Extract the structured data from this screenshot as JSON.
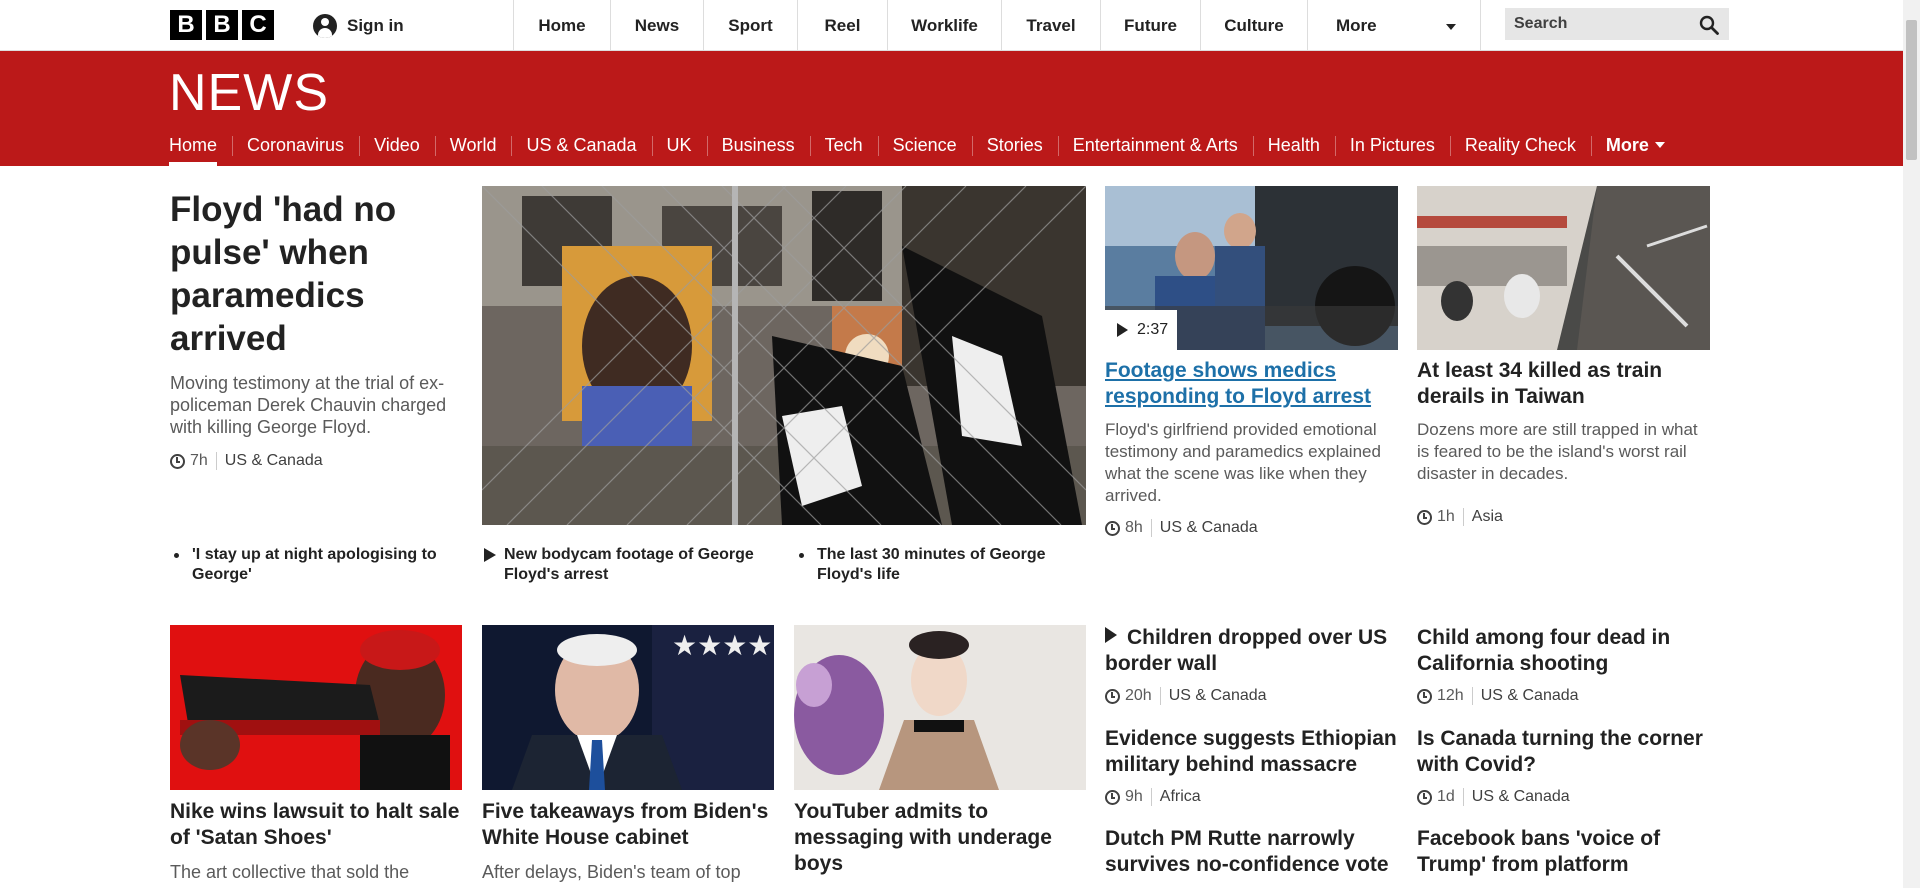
{
  "topbar": {
    "logo_letters": [
      "B",
      "B",
      "C"
    ],
    "signin_label": "Sign in",
    "nav": [
      "Home",
      "News",
      "Sport",
      "Reel",
      "Worklife",
      "Travel",
      "Future",
      "Culture"
    ],
    "more_label": "More",
    "search_placeholder": "Search"
  },
  "news": {
    "logo": "NEWS",
    "subnav": [
      "Home",
      "Coronavirus",
      "Video",
      "World",
      "US & Canada",
      "UK",
      "Business",
      "Tech",
      "Science",
      "Stories",
      "Entertainment & Arts",
      "Health",
      "In Pictures",
      "Reality Check"
    ],
    "subnav_more": "More",
    "active_item": "Home"
  },
  "lead": {
    "title": "Floyd 'had no pulse' when paramedics arrived",
    "summary": "Moving testimony at the trial of ex-policeman Derek Chauvin charged with killing George Floyd.",
    "time": "7h",
    "section": "US & Canada",
    "related": [
      {
        "type": "text",
        "label": "'I stay up at night apologising to George'"
      },
      {
        "type": "video",
        "label": "New bodycam footage of George Floyd's arrest"
      },
      {
        "type": "text",
        "label": "The last 30 minutes of George Floyd's life"
      }
    ]
  },
  "top_right": [
    {
      "title": "Footage shows medics responding to Floyd arrest",
      "summary": "Floyd's girlfriend provided emotional testimony and paramedics explained what the scene was like when they arrived.",
      "time": "8h",
      "section": "US & Canada",
      "video_duration": "2:37"
    },
    {
      "title": "At least 34 killed as train derails in Taiwan",
      "summary": "Dozens more are still trapped in what is feared to be the island's worst rail disaster in decades.",
      "time": "1h",
      "section": "Asia"
    }
  ],
  "row2": [
    {
      "title": "Nike wins lawsuit to halt sale of 'Satan Shoes'",
      "summary": "The art collective that sold the"
    },
    {
      "title": "Five takeaways from Biden's White House cabinet",
      "summary": "After delays, Biden's team of top"
    },
    {
      "title": "YouTuber admits to messaging with underage boys",
      "summary": ""
    }
  ],
  "list_col1": [
    {
      "title": "Children dropped over US border wall",
      "time": "20h",
      "section": "US & Canada",
      "video": true
    },
    {
      "title": "Evidence suggests Ethiopian military behind massacre",
      "time": "9h",
      "section": "Africa"
    },
    {
      "title": "Dutch PM Rutte narrowly survives no-confidence vote"
    }
  ],
  "list_col2": [
    {
      "title": "Child among four dead in California shooting",
      "time": "12h",
      "section": "US & Canada"
    },
    {
      "title": "Is Canada turning the corner with Covid?",
      "time": "1d",
      "section": "US & Canada"
    },
    {
      "title": "Facebook bans 'voice of Trump' from platform"
    }
  ],
  "colors": {
    "news_red": "#bb1919",
    "link_blue": "#1d70a8"
  },
  "icons": [
    "user-icon",
    "search-icon",
    "clock-icon",
    "play-icon",
    "chevron-down-icon"
  ]
}
